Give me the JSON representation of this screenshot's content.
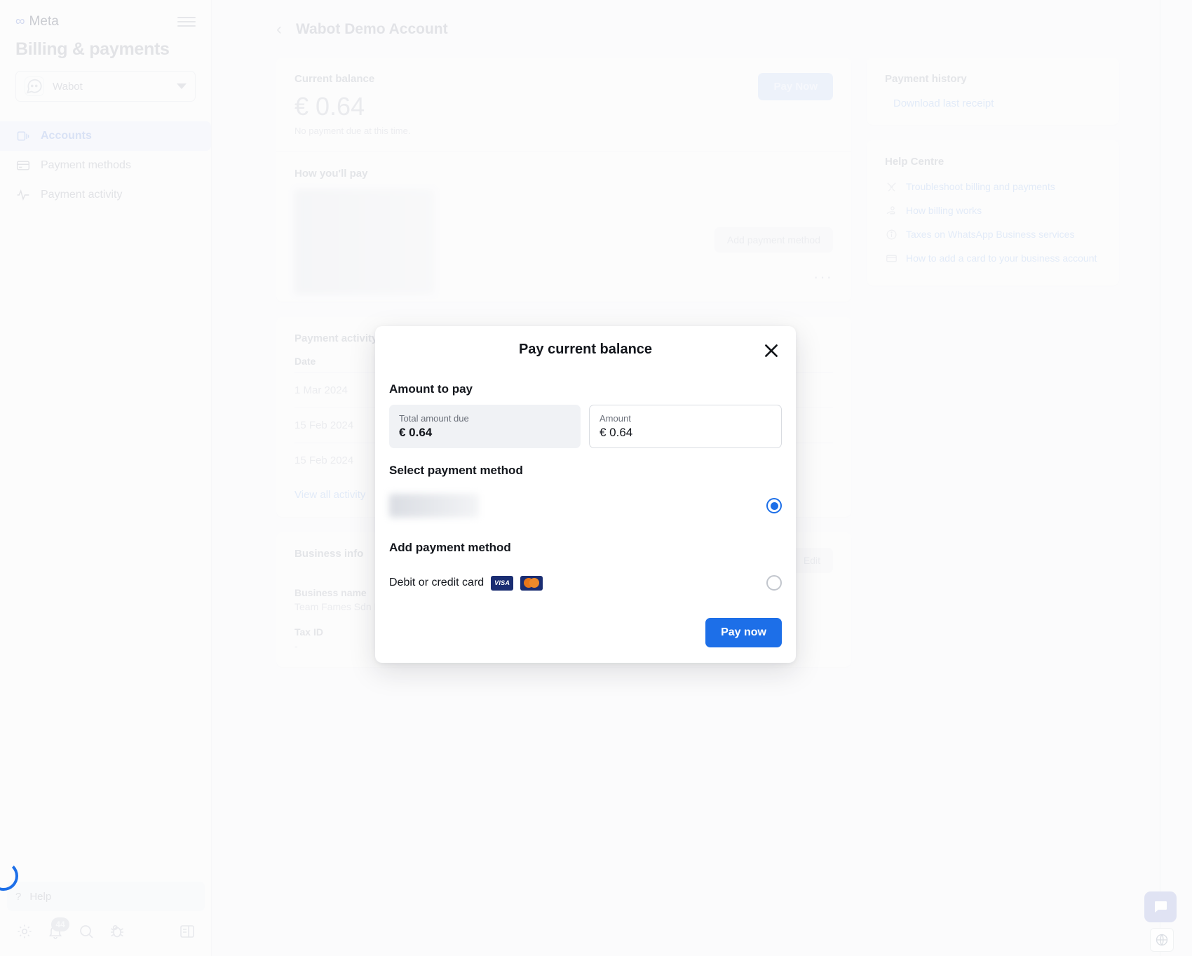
{
  "sidebar": {
    "brand": "Meta",
    "brand_icon": "meta-infinity-icon",
    "menu_icon": "hamburger-icon",
    "title": "Billing & payments",
    "account": {
      "name": "Wabot",
      "avatar_icon": "whatsapp-bubble-icon",
      "caret_icon": "chevron-down-icon"
    },
    "items": [
      {
        "label": "Accounts",
        "icon": "accounts-icon",
        "active": true
      },
      {
        "label": "Payment methods",
        "icon": "credit-card-icon",
        "active": false
      },
      {
        "label": "Payment activity",
        "icon": "activity-pulse-icon",
        "active": false
      }
    ],
    "help": {
      "label": "Help",
      "icon": "question-mark-icon"
    },
    "tools": [
      {
        "icon": "gear-icon",
        "badge": ""
      },
      {
        "icon": "bell-icon",
        "badge": "44"
      },
      {
        "icon": "search-icon",
        "badge": ""
      },
      {
        "icon": "bug-icon",
        "badge": ""
      },
      {
        "icon": "panel-layout-icon",
        "badge": ""
      }
    ]
  },
  "page": {
    "back_icon": "chevron-left-icon",
    "title": "Wabot Demo Account"
  },
  "balance_card": {
    "label": "Current balance",
    "amount": "€ 0.64",
    "note": "No payment due at this time.",
    "pay_now_label": "Pay Now"
  },
  "how_you_pay": {
    "label": "How you'll pay",
    "add_payment_method_label": "Add payment method",
    "overflow_icon": "ellipsis-icon"
  },
  "payment_activity": {
    "label": "Payment activity",
    "columns": [
      "Date"
    ],
    "rows": [
      {
        "date": "1 Mar 2024"
      },
      {
        "date": "15 Feb 2024"
      },
      {
        "date": "15 Feb 2024"
      }
    ],
    "view_all_label": "View all activity"
  },
  "business_info": {
    "label": "Business info",
    "edit_label": "Edit",
    "fields": [
      {
        "key": "Business name",
        "value": "Team Fames Sdn Bhd"
      },
      {
        "key": "Tax ID",
        "value": "-"
      }
    ]
  },
  "payment_history": {
    "title": "Payment history",
    "download_label": "Download last receipt",
    "download_icon": "download-icon"
  },
  "help_centre": {
    "title": "Help Centre",
    "links": [
      {
        "label": "Troubleshoot billing and payments",
        "icon": "tools-icon"
      },
      {
        "label": "How billing works",
        "icon": "hand-coin-icon"
      },
      {
        "label": "Taxes on WhatsApp Business services",
        "icon": "info-circle-icon"
      },
      {
        "label": "How to add a card to your business account",
        "icon": "card-add-icon"
      }
    ]
  },
  "modal": {
    "title": "Pay current balance",
    "close_icon": "close-icon",
    "amount_section_title": "Amount to pay",
    "total_due": {
      "label": "Total amount due",
      "value": "€ 0.64"
    },
    "amount_input": {
      "label": "Amount",
      "value": "€ 0.64",
      "placeholder": "Amount"
    },
    "select_section_title": "Select payment method",
    "saved_method": {
      "redacted": true,
      "selected": true
    },
    "add_section_title": "Add payment method",
    "card_option": {
      "label": "Debit or credit card",
      "visa_label": "VISA",
      "visa_icon": "visa-icon",
      "mastercard_icon": "mastercard-icon",
      "selected": false
    },
    "pay_now_label": "Pay now",
    "accent_color": "#1d6fe8"
  },
  "widgets": {
    "chat_icon": "chat-bubble-icon",
    "globe_icon": "globe-icon"
  }
}
